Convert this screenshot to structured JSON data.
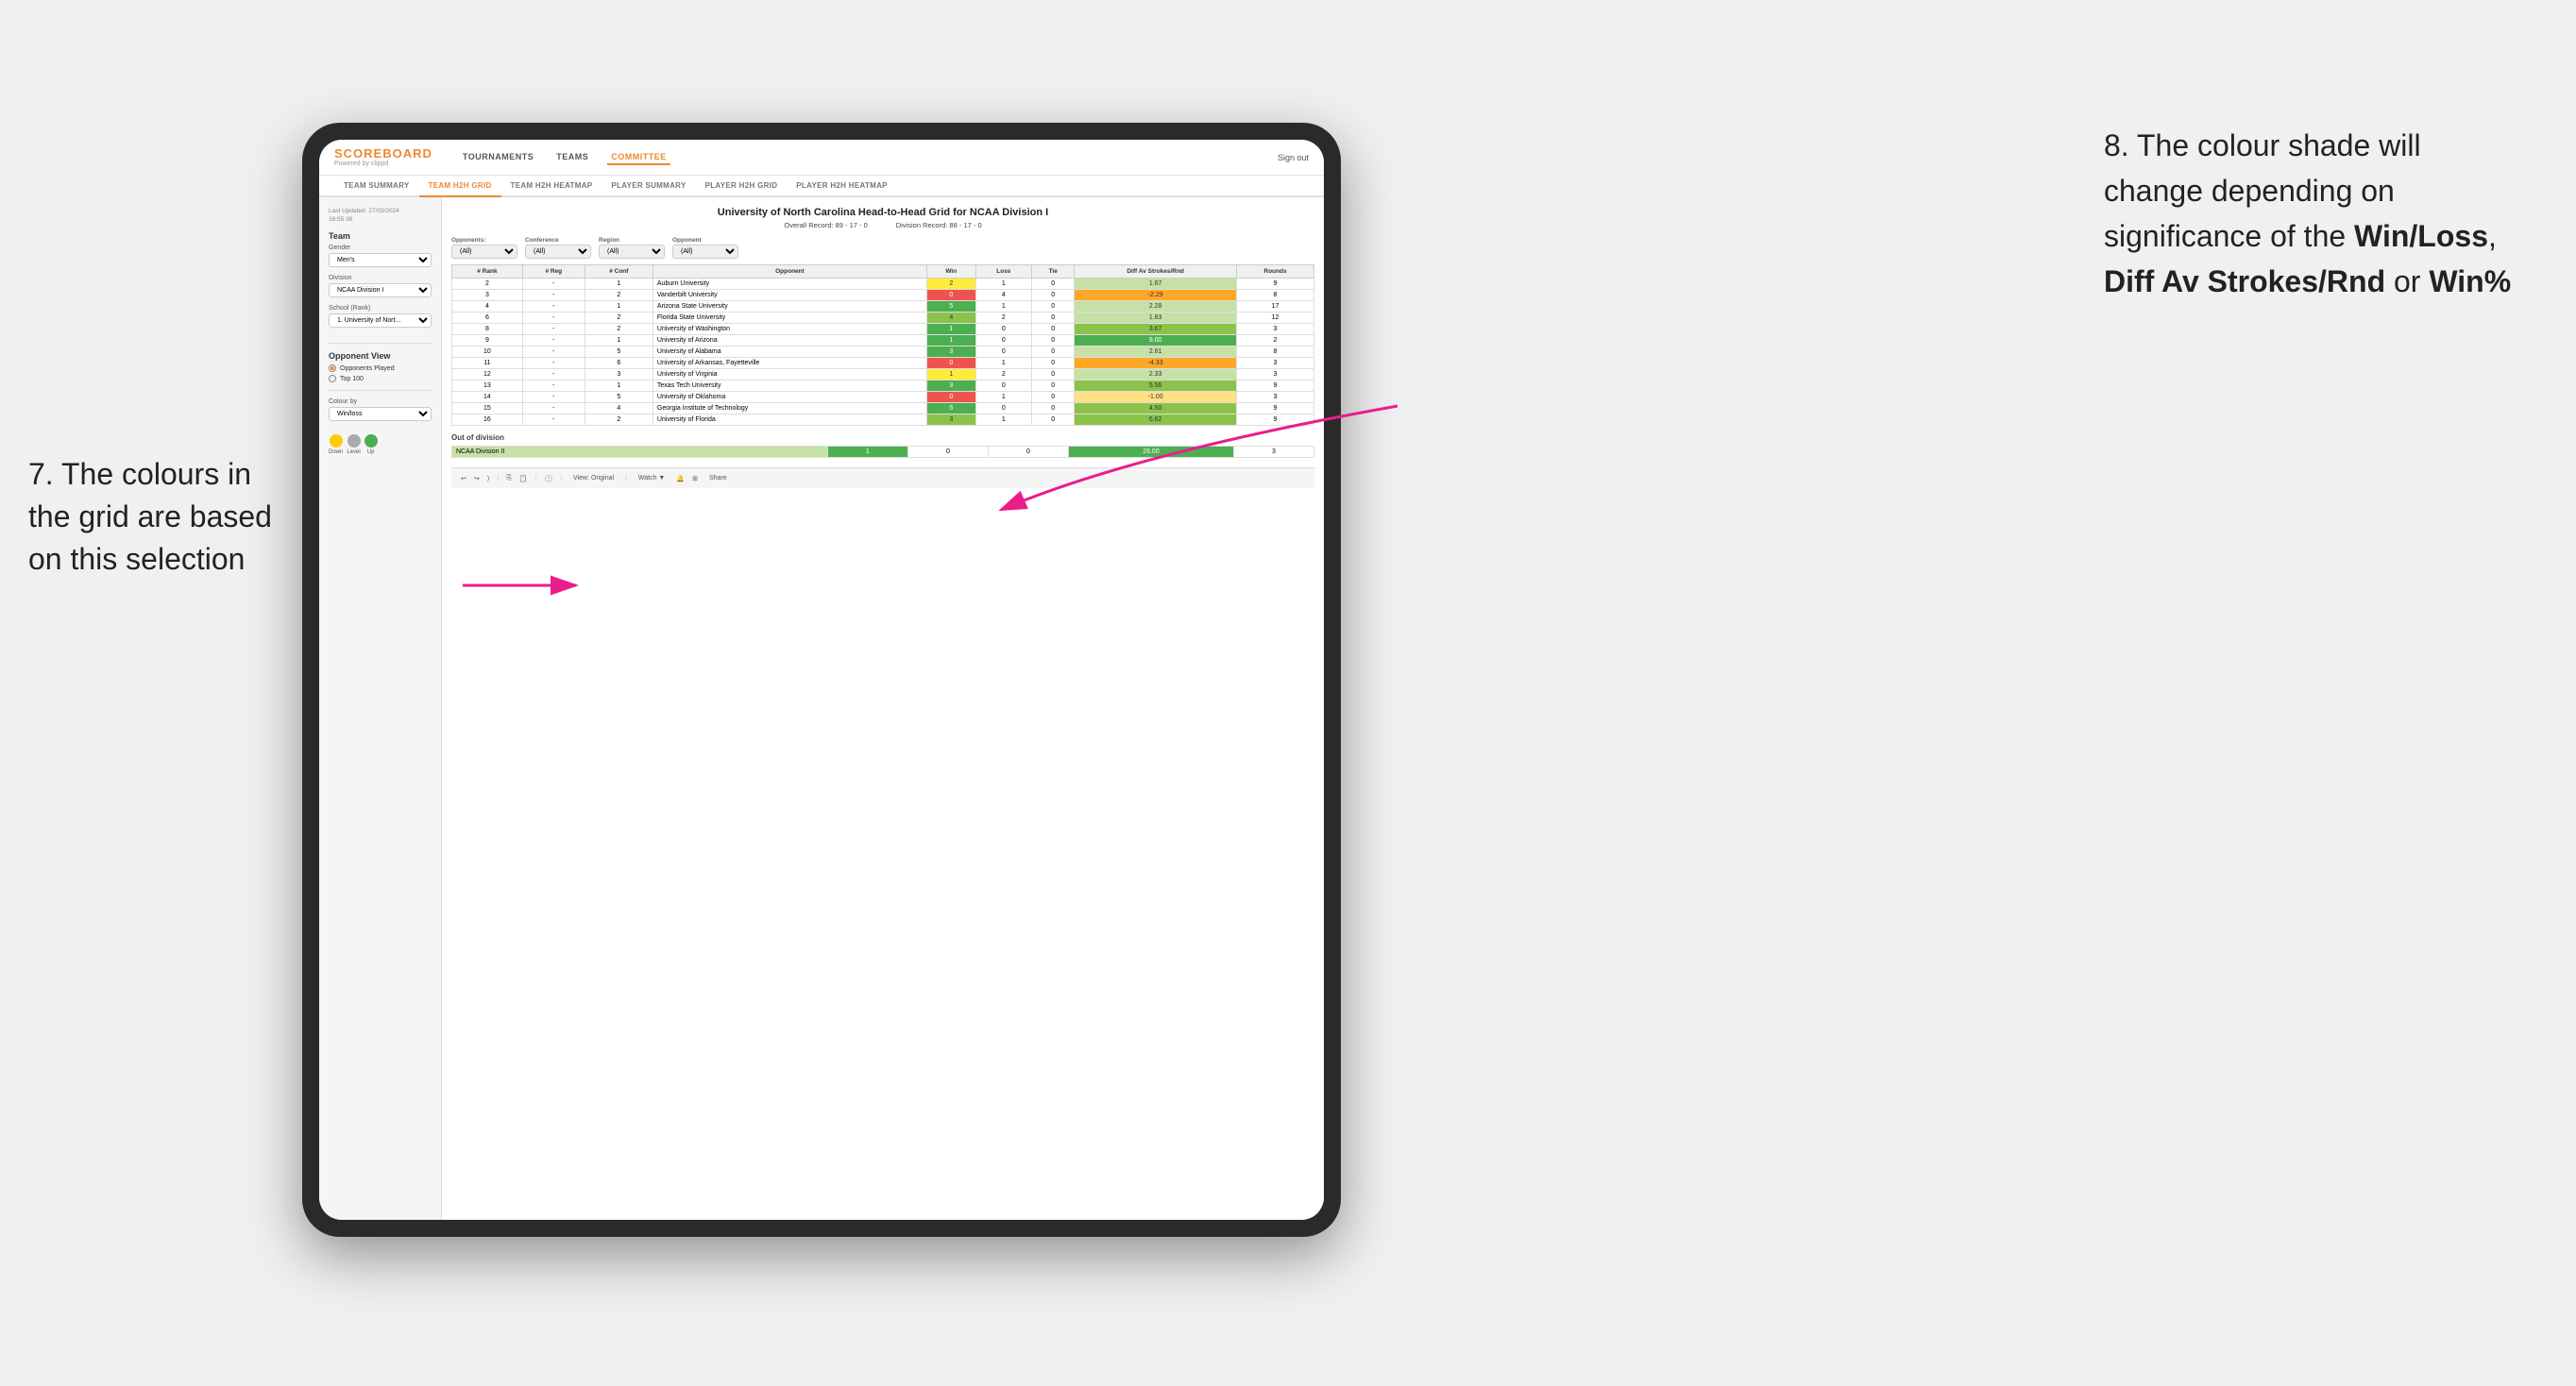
{
  "annotations": {
    "left": {
      "line1": "7. The colours in",
      "line2": "the grid are based",
      "line3": "on this selection"
    },
    "right": {
      "intro": "8. The colour shade will change depending on significance of the ",
      "bold1": "Win/Loss",
      "sep1": ", ",
      "bold2": "Diff Av Strokes/Rnd",
      "sep2": " or ",
      "bold3": "Win%"
    }
  },
  "header": {
    "logo": "SCOREBOARD",
    "logo_sub": "Powered by clippd",
    "nav": [
      "TOURNAMENTS",
      "TEAMS",
      "COMMITTEE"
    ],
    "sign_out": "Sign out"
  },
  "sub_nav": [
    "TEAM SUMMARY",
    "TEAM H2H GRID",
    "TEAM H2H HEATMAP",
    "PLAYER SUMMARY",
    "PLAYER H2H GRID",
    "PLAYER H2H HEATMAP"
  ],
  "sub_nav_active": "TEAM H2H GRID",
  "left_panel": {
    "timestamp": "Last Updated: 27/03/2024\n16:55:38",
    "team_label": "Team",
    "gender_label": "Gender",
    "gender_value": "Men's",
    "division_label": "Division",
    "division_value": "NCAA Division I",
    "school_label": "School (Rank)",
    "school_value": "1. University of Nort...",
    "opponent_view_label": "Opponent View",
    "opponent_view_options": [
      "Opponents Played",
      "Top 100"
    ],
    "opponent_view_selected": "Opponents Played",
    "colour_by_label": "Colour by",
    "colour_by_value": "Win/loss",
    "legend": {
      "down": "Down",
      "level": "Level",
      "up": "Up"
    }
  },
  "grid": {
    "title": "University of North Carolina Head-to-Head Grid for NCAA Division I",
    "overall_record": "Overall Record: 89 - 17 - 0",
    "division_record": "Division Record: 88 - 17 - 0",
    "filters": {
      "opponents_label": "Opponents:",
      "opponents_value": "(All)",
      "conference_label": "Conference",
      "conference_value": "(All)",
      "region_label": "Region",
      "region_value": "(All)",
      "opponent_label": "Opponent",
      "opponent_value": "(All)"
    },
    "columns": [
      "# Rank",
      "# Reg",
      "# Conf",
      "Opponent",
      "Win",
      "Loss",
      "Tie",
      "Diff Av Strokes/Rnd",
      "Rounds"
    ],
    "rows": [
      {
        "rank": "2",
        "reg": "-",
        "conf": "1",
        "opponent": "Auburn University",
        "win": "2",
        "loss": "1",
        "tie": "0",
        "diff": "1.67",
        "rounds": "9",
        "win_color": "yellow",
        "diff_color": "green_light"
      },
      {
        "rank": "3",
        "reg": "-",
        "conf": "2",
        "opponent": "Vanderbilt University",
        "win": "0",
        "loss": "4",
        "tie": "0",
        "diff": "-2.29",
        "rounds": "8",
        "win_color": "red",
        "diff_color": "orange"
      },
      {
        "rank": "4",
        "reg": "-",
        "conf": "1",
        "opponent": "Arizona State University",
        "win": "5",
        "loss": "1",
        "tie": "0",
        "diff": "2.28",
        "rounds": "17",
        "win_color": "green_dark",
        "diff_color": "green_light"
      },
      {
        "rank": "6",
        "reg": "-",
        "conf": "2",
        "opponent": "Florida State University",
        "win": "4",
        "loss": "2",
        "tie": "0",
        "diff": "1.83",
        "rounds": "12",
        "win_color": "green_mid",
        "diff_color": "green_light"
      },
      {
        "rank": "8",
        "reg": "-",
        "conf": "2",
        "opponent": "University of Washington",
        "win": "1",
        "loss": "0",
        "tie": "0",
        "diff": "3.67",
        "rounds": "3",
        "win_color": "green_dark",
        "diff_color": "green_mid"
      },
      {
        "rank": "9",
        "reg": "-",
        "conf": "1",
        "opponent": "University of Arizona",
        "win": "1",
        "loss": "0",
        "tie": "0",
        "diff": "9.00",
        "rounds": "2",
        "win_color": "green_dark",
        "diff_color": "green_dark"
      },
      {
        "rank": "10",
        "reg": "-",
        "conf": "5",
        "opponent": "University of Alabama",
        "win": "3",
        "loss": "0",
        "tie": "0",
        "diff": "2.61",
        "rounds": "8",
        "win_color": "green_dark",
        "diff_color": "green_light"
      },
      {
        "rank": "11",
        "reg": "-",
        "conf": "6",
        "opponent": "University of Arkansas, Fayetteville",
        "win": "0",
        "loss": "1",
        "tie": "0",
        "diff": "-4.33",
        "rounds": "3",
        "win_color": "red",
        "diff_color": "orange"
      },
      {
        "rank": "12",
        "reg": "-",
        "conf": "3",
        "opponent": "University of Virginia",
        "win": "1",
        "loss": "2",
        "tie": "0",
        "diff": "2.33",
        "rounds": "3",
        "win_color": "yellow",
        "diff_color": "green_light"
      },
      {
        "rank": "13",
        "reg": "-",
        "conf": "1",
        "opponent": "Texas Tech University",
        "win": "3",
        "loss": "0",
        "tie": "0",
        "diff": "5.56",
        "rounds": "9",
        "win_color": "green_dark",
        "diff_color": "green_mid"
      },
      {
        "rank": "14",
        "reg": "-",
        "conf": "5",
        "opponent": "University of Oklahoma",
        "win": "0",
        "loss": "1",
        "tie": "0",
        "diff": "-1.00",
        "rounds": "3",
        "win_color": "red",
        "diff_color": "orange_light"
      },
      {
        "rank": "15",
        "reg": "-",
        "conf": "4",
        "opponent": "Georgia Institute of Technology",
        "win": "5",
        "loss": "0",
        "tie": "0",
        "diff": "4.50",
        "rounds": "9",
        "win_color": "green_dark",
        "diff_color": "green_mid"
      },
      {
        "rank": "16",
        "reg": "-",
        "conf": "2",
        "opponent": "University of Florida",
        "win": "3",
        "loss": "1",
        "tie": "0",
        "diff": "6.62",
        "rounds": "9",
        "win_color": "green_mid",
        "diff_color": "green_mid"
      }
    ],
    "out_of_division_label": "Out of division",
    "out_of_division_rows": [
      {
        "opponent": "NCAA Division II",
        "win": "1",
        "loss": "0",
        "tie": "0",
        "diff": "26.00",
        "rounds": "3",
        "win_color": "green_dark",
        "diff_color": "green_dark"
      }
    ]
  },
  "toolbar": {
    "view_label": "View: Original",
    "watch_label": "Watch ▼",
    "share_label": "Share"
  }
}
